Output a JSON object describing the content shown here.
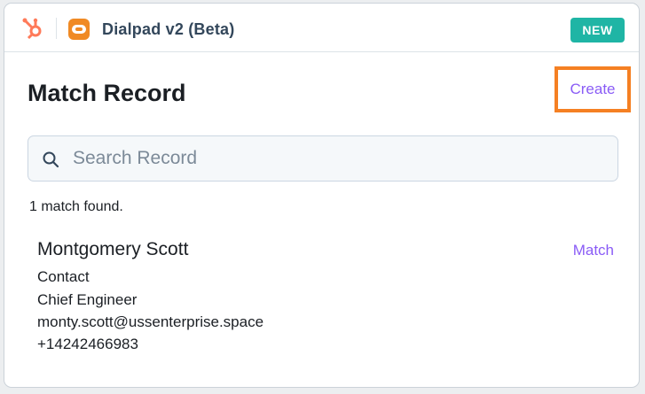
{
  "header": {
    "app_icon": "hubspot-logo",
    "integration_icon": "dialpad-icon",
    "app_title": "Dialpad v2 (Beta)",
    "badge": "NEW"
  },
  "main": {
    "title": "Match Record",
    "create_label": "Create",
    "search": {
      "placeholder": "Search Record",
      "value": "",
      "icon": "search-icon"
    },
    "result_summary": "1 match found.",
    "results": [
      {
        "name": "Montgomery Scott",
        "type": "Contact",
        "job_title": "Chief Engineer",
        "email": "monty.scott@ussenterprise.space",
        "phone": "+14242466983",
        "action_label": "Match"
      }
    ]
  },
  "colors": {
    "accent_link": "#8a5cf6",
    "highlight_border": "#f58023",
    "badge_bg": "#1fb5a5",
    "hubspot_orange": "#ff7a59",
    "dialpad_orange": "#f08a24"
  }
}
